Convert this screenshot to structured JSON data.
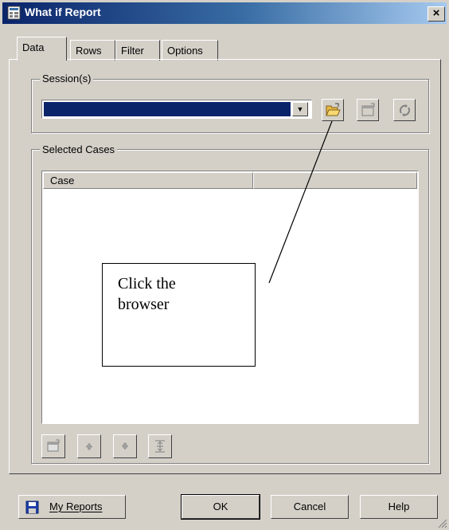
{
  "window": {
    "title": "What if Report",
    "close_label": "×"
  },
  "tabs": [
    {
      "label": "Data",
      "active": true
    },
    {
      "label": "Rows",
      "active": false
    },
    {
      "label": "Filter",
      "active": false
    },
    {
      "label": "Options",
      "active": false
    }
  ],
  "session_group": {
    "legend": "Session(s)",
    "selected_value": ""
  },
  "cases_group": {
    "legend": "Selected Cases",
    "columns": [
      "Case",
      ""
    ]
  },
  "annotation": {
    "line1": "Click the",
    "line2": "browser"
  },
  "footer": {
    "my_reports": "My Reports",
    "ok": "OK",
    "cancel": "Cancel",
    "help": "Help"
  },
  "colors": {
    "title_bar": "#0a246a",
    "face": "#d4d0c8",
    "selection": "#0a246a"
  },
  "icons": [
    "open-folder-icon",
    "new-session-icon",
    "refresh-icon",
    "properties-icon",
    "move-up-icon",
    "move-down-icon",
    "sort-icon",
    "save-disk-icon"
  ]
}
